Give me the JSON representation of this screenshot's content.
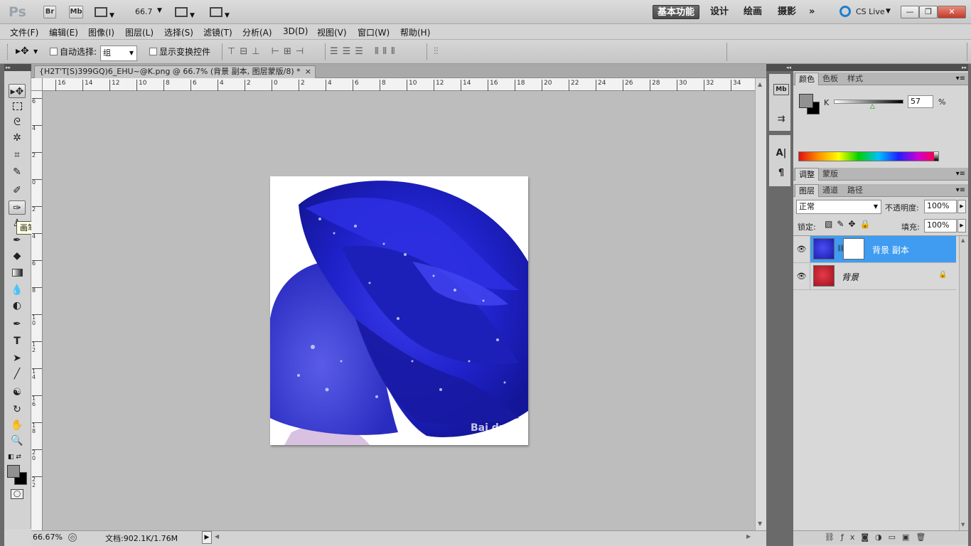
{
  "app": {
    "logo": "Ps",
    "zoom": "66.7",
    "workspaces": [
      "基本功能",
      "设计",
      "绘画",
      "摄影"
    ],
    "cs_live": "CS Live",
    "bridge_label": "Br",
    "minibridge_label": "Mb"
  },
  "menu": [
    "文件(F)",
    "编辑(E)",
    "图像(I)",
    "图层(L)",
    "选择(S)",
    "滤镜(T)",
    "分析(A)",
    "3D(D)",
    "视图(V)",
    "窗口(W)",
    "帮助(H)"
  ],
  "options": {
    "auto_select_label": "自动选择:",
    "auto_select_value": "组",
    "show_transform_label": "显示变换控件"
  },
  "document": {
    "tab_title": "{H2T'T[S)399GQ)6_EHU~@K.png @ 66.7% (背景 副本, 图层蒙版/8) *",
    "close": "×"
  },
  "ruler_h": [
    "16",
    "14",
    "12",
    "10",
    "8",
    "6",
    "4",
    "2",
    "0",
    "2",
    "4",
    "6",
    "8",
    "10",
    "12",
    "14",
    "16",
    "18",
    "20",
    "22",
    "24",
    "26",
    "28",
    "30",
    "32",
    "34"
  ],
  "ruler_v": [
    "6",
    "4",
    "2",
    "0",
    "2",
    "4",
    "6",
    "8",
    "10",
    "12",
    "14",
    "16",
    "18",
    "20",
    "22"
  ],
  "tooltip": "画笔工具 (B)",
  "status": {
    "zoom": "66.67%",
    "doc_info": "文档:902.1K/1.76M"
  },
  "color_panel": {
    "tabs": [
      "颜色",
      "色板",
      "样式"
    ],
    "channel_label": "K",
    "value": "57",
    "unit": "%",
    "slider_level": 0.57,
    "fg_color": "#919191",
    "bg_color": "#000000"
  },
  "adjust_panel": {
    "tabs": [
      "调整",
      "蒙版"
    ]
  },
  "layers_panel": {
    "tabs": [
      "图层",
      "通道",
      "路径"
    ],
    "blend_mode": "正常",
    "opacity_label": "不透明度:",
    "opacity": "100%",
    "lock_label": "锁定:",
    "fill_label": "填充:",
    "fill": "100%",
    "layers": [
      {
        "name": "背景 副本",
        "selected": true,
        "has_mask": true,
        "thumb_color": "#2b2fd0"
      },
      {
        "name": "背景",
        "selected": false,
        "locked": true,
        "thumb_color": "#c8202e"
      }
    ]
  },
  "watermark": "Bai du"
}
